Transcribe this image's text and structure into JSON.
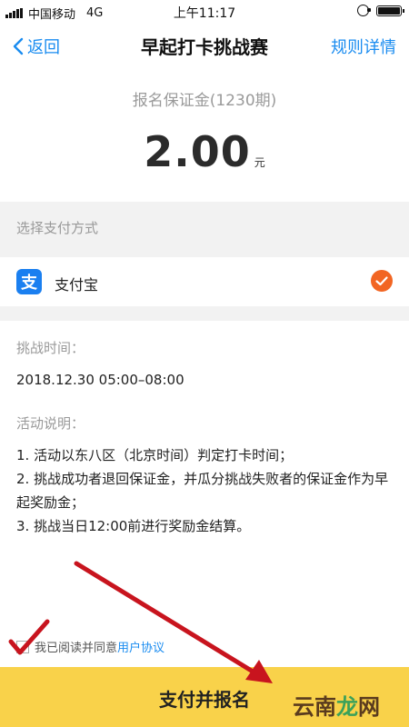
{
  "status_bar": {
    "carrier": "中国移动",
    "network": "4G",
    "time": "上午11:17"
  },
  "nav": {
    "back_label": "返回",
    "title": "早起打卡挑战赛",
    "rules_label": "规则详情"
  },
  "deposit": {
    "label": "报名保证金(1230期)",
    "amount": "2.00",
    "unit": "元"
  },
  "payment": {
    "section_label": "选择支付方式",
    "method_name": "支付宝",
    "method_icon": "alipay-icon",
    "selected": true
  },
  "challenge": {
    "time_label": "挑战时间：",
    "time_value": "2018.12.30 05:00–08:00",
    "desc_label": "活动说明：",
    "rules": [
      "1. 活动以东八区（北京时间）判定打卡时间；",
      "2. 挑战成功者退回保证金，并瓜分挑战失败者的保证金作为早起奖励金；",
      "3. 挑战当日12:00前进行奖励金结算。"
    ]
  },
  "agreement": {
    "text": "我已阅读并同意",
    "link": "用户协议",
    "checked": false
  },
  "submit": {
    "label": "支付并报名"
  },
  "watermark": {
    "c1": "云",
    "c2": "南",
    "c3": "龙",
    "c4": "网"
  },
  "colors": {
    "accent_blue": "#1a8cf0",
    "check_orange": "#f26522",
    "submit_yellow": "#f9d24a",
    "annotation_red": "#c8141e"
  }
}
